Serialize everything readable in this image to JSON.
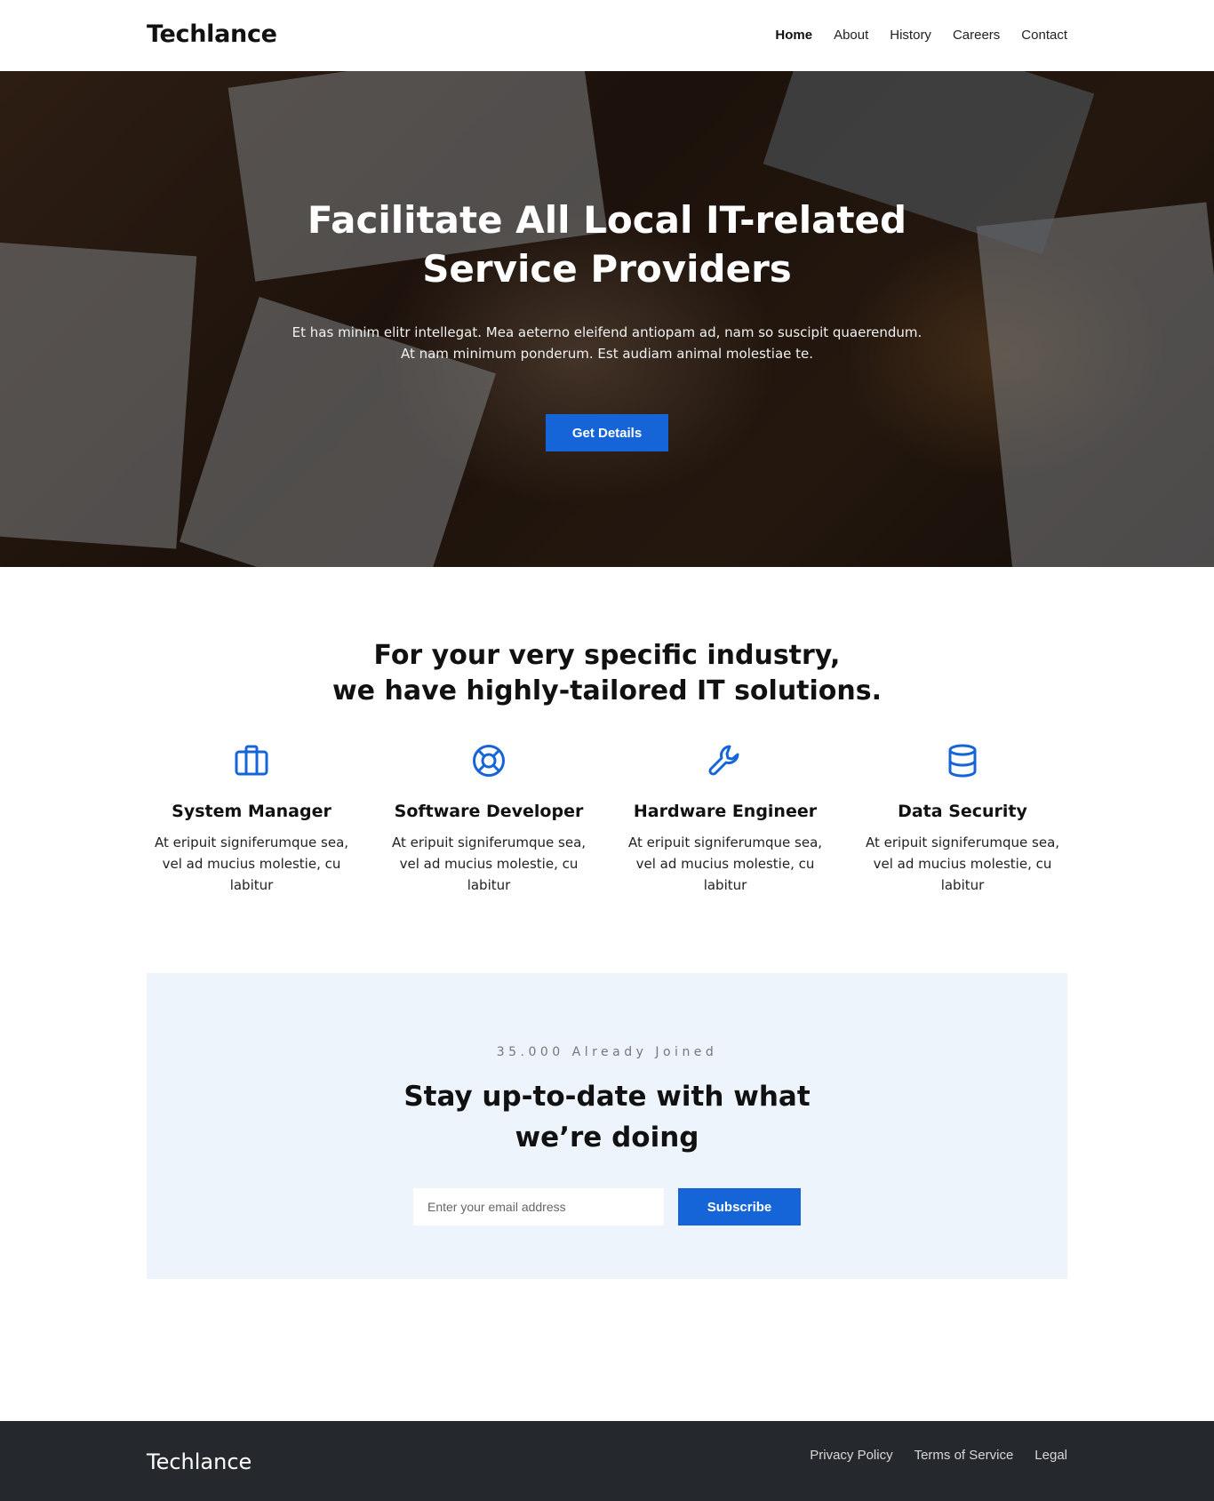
{
  "header": {
    "logo": "Techlance",
    "nav": [
      "Home",
      "About",
      "History",
      "Careers",
      "Contact"
    ],
    "active_nav": "Home"
  },
  "hero": {
    "title_line1": "Facilitate All Local IT-related",
    "title_line2": "Service Providers",
    "subtitle_line1": "Et has minim elitr intellegat. Mea aeterno eleifend antiopam ad, nam so suscipit quaerendum.",
    "subtitle_line2": "At nam minimum ponderum. Est audiam animal molestiae te.",
    "button_label": "Get Details"
  },
  "services": {
    "title_line1": "For your very specific industry,",
    "title_line2": "we have highly-tailored IT solutions.",
    "items": [
      {
        "icon": "briefcase-icon",
        "title": "System Manager",
        "text": "At eripuit signiferumque sea, vel ad mucius molestie, cu labitur"
      },
      {
        "icon": "lifebuoy-icon",
        "title": "Software Developer",
        "text": "At eripuit signiferumque sea, vel ad mucius molestie, cu labitur"
      },
      {
        "icon": "wrench-icon",
        "title": "Hardware Engineer",
        "text": "At eripuit signiferumque sea, vel ad mucius molestie, cu labitur"
      },
      {
        "icon": "database-icon",
        "title": "Data Security",
        "text": "At eripuit signiferumque sea, vel ad mucius molestie, cu labitur"
      }
    ]
  },
  "subscribe": {
    "kicker": "35.000 Already Joined",
    "title_line1": "Stay up-to-date with what",
    "title_line2": "we’re doing",
    "input_placeholder": "Enter your email address",
    "button_label": "Subscribe"
  },
  "footer": {
    "logo": "Techlance",
    "links": [
      "Privacy Policy",
      "Terms of Service",
      "Legal"
    ]
  },
  "colors": {
    "accent": "#1565d8",
    "subscribe_bg": "#edf4fc",
    "footer_bg": "#25282c"
  }
}
